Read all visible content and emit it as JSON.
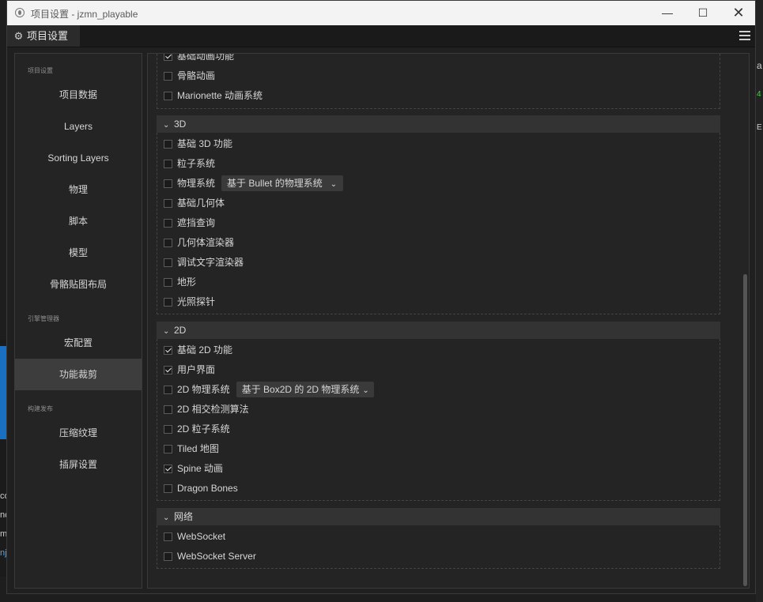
{
  "window": {
    "title": "项目设置 - jzmn_playable",
    "minimize": "—",
    "maximize": "☐",
    "close": "✕"
  },
  "tab": {
    "label": "项目设置"
  },
  "sidebar": {
    "groups": [
      {
        "label": "项目设置",
        "items": [
          "项目数据",
          "Layers",
          "Sorting Layers",
          "物理",
          "脚本",
          "模型",
          "骨骼贴图布局"
        ]
      },
      {
        "label": "引擎管理器",
        "items": [
          "宏配置",
          "功能裁剪"
        ]
      },
      {
        "label": "构建发布",
        "items": [
          "压缩纹理",
          "插屏设置"
        ]
      }
    ],
    "active": "功能裁剪"
  },
  "animation": {
    "items": [
      {
        "label": "基础动画功能",
        "checked": true
      },
      {
        "label": "骨骼动画",
        "checked": false
      },
      {
        "label": "Marionette 动画系统",
        "checked": false
      }
    ]
  },
  "section_3d": {
    "title": "3D",
    "items": [
      {
        "label": "基础 3D 功能",
        "checked": false
      },
      {
        "label": "粒子系统",
        "checked": false
      },
      {
        "label": "物理系统",
        "checked": false,
        "dropdown": "基于 Bullet 的物理系统"
      },
      {
        "label": "基础几何体",
        "checked": false
      },
      {
        "label": "遮挡查询",
        "checked": false
      },
      {
        "label": "几何体渲染器",
        "checked": false
      },
      {
        "label": "调试文字渲染器",
        "checked": false
      },
      {
        "label": "地形",
        "checked": false
      },
      {
        "label": "光照探针",
        "checked": false
      }
    ]
  },
  "section_2d": {
    "title": "2D",
    "items": [
      {
        "label": "基础 2D 功能",
        "checked": true
      },
      {
        "label": "用户界面",
        "checked": true
      },
      {
        "label": "2D 物理系统",
        "checked": false,
        "dropdown": "基于 Box2D 的 2D 物理系统"
      },
      {
        "label": "2D 相交检测算法",
        "checked": false
      },
      {
        "label": "2D 粒子系统",
        "checked": false
      },
      {
        "label": "Tiled 地图",
        "checked": false
      },
      {
        "label": "Spine 动画",
        "checked": true
      },
      {
        "label": "Dragon Bones",
        "checked": false
      }
    ]
  },
  "section_net": {
    "title": "网络",
    "items": [
      {
        "label": "WebSocket",
        "checked": false
      },
      {
        "label": "WebSocket Server",
        "checked": false
      }
    ]
  },
  "background": {
    "right_chars": [
      "a",
      "4",
      "E"
    ],
    "left_chars": [
      "co",
      "nc",
      "m",
      "nj"
    ]
  }
}
